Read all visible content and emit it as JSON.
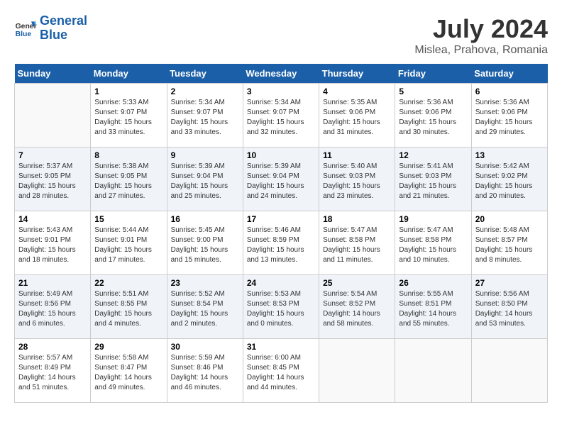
{
  "header": {
    "logo_line1": "General",
    "logo_line2": "Blue",
    "month": "July 2024",
    "location": "Mislea, Prahova, Romania"
  },
  "days_of_week": [
    "Sunday",
    "Monday",
    "Tuesday",
    "Wednesday",
    "Thursday",
    "Friday",
    "Saturday"
  ],
  "weeks": [
    [
      {
        "day": "",
        "sunrise": "",
        "sunset": "",
        "daylight": "",
        "empty": true
      },
      {
        "day": "1",
        "sunrise": "5:33 AM",
        "sunset": "9:07 PM",
        "daylight": "15 hours and 33 minutes."
      },
      {
        "day": "2",
        "sunrise": "5:34 AM",
        "sunset": "9:07 PM",
        "daylight": "15 hours and 33 minutes."
      },
      {
        "day": "3",
        "sunrise": "5:34 AM",
        "sunset": "9:07 PM",
        "daylight": "15 hours and 32 minutes."
      },
      {
        "day": "4",
        "sunrise": "5:35 AM",
        "sunset": "9:06 PM",
        "daylight": "15 hours and 31 minutes."
      },
      {
        "day": "5",
        "sunrise": "5:36 AM",
        "sunset": "9:06 PM",
        "daylight": "15 hours and 30 minutes."
      },
      {
        "day": "6",
        "sunrise": "5:36 AM",
        "sunset": "9:06 PM",
        "daylight": "15 hours and 29 minutes."
      }
    ],
    [
      {
        "day": "7",
        "sunrise": "5:37 AM",
        "sunset": "9:05 PM",
        "daylight": "15 hours and 28 minutes."
      },
      {
        "day": "8",
        "sunrise": "5:38 AM",
        "sunset": "9:05 PM",
        "daylight": "15 hours and 27 minutes."
      },
      {
        "day": "9",
        "sunrise": "5:39 AM",
        "sunset": "9:04 PM",
        "daylight": "15 hours and 25 minutes."
      },
      {
        "day": "10",
        "sunrise": "5:39 AM",
        "sunset": "9:04 PM",
        "daylight": "15 hours and 24 minutes."
      },
      {
        "day": "11",
        "sunrise": "5:40 AM",
        "sunset": "9:03 PM",
        "daylight": "15 hours and 23 minutes."
      },
      {
        "day": "12",
        "sunrise": "5:41 AM",
        "sunset": "9:03 PM",
        "daylight": "15 hours and 21 minutes."
      },
      {
        "day": "13",
        "sunrise": "5:42 AM",
        "sunset": "9:02 PM",
        "daylight": "15 hours and 20 minutes."
      }
    ],
    [
      {
        "day": "14",
        "sunrise": "5:43 AM",
        "sunset": "9:01 PM",
        "daylight": "15 hours and 18 minutes."
      },
      {
        "day": "15",
        "sunrise": "5:44 AM",
        "sunset": "9:01 PM",
        "daylight": "15 hours and 17 minutes."
      },
      {
        "day": "16",
        "sunrise": "5:45 AM",
        "sunset": "9:00 PM",
        "daylight": "15 hours and 15 minutes."
      },
      {
        "day": "17",
        "sunrise": "5:46 AM",
        "sunset": "8:59 PM",
        "daylight": "15 hours and 13 minutes."
      },
      {
        "day": "18",
        "sunrise": "5:47 AM",
        "sunset": "8:58 PM",
        "daylight": "15 hours and 11 minutes."
      },
      {
        "day": "19",
        "sunrise": "5:47 AM",
        "sunset": "8:58 PM",
        "daylight": "15 hours and 10 minutes."
      },
      {
        "day": "20",
        "sunrise": "5:48 AM",
        "sunset": "8:57 PM",
        "daylight": "15 hours and 8 minutes."
      }
    ],
    [
      {
        "day": "21",
        "sunrise": "5:49 AM",
        "sunset": "8:56 PM",
        "daylight": "15 hours and 6 minutes."
      },
      {
        "day": "22",
        "sunrise": "5:51 AM",
        "sunset": "8:55 PM",
        "daylight": "15 hours and 4 minutes."
      },
      {
        "day": "23",
        "sunrise": "5:52 AM",
        "sunset": "8:54 PM",
        "daylight": "15 hours and 2 minutes."
      },
      {
        "day": "24",
        "sunrise": "5:53 AM",
        "sunset": "8:53 PM",
        "daylight": "15 hours and 0 minutes."
      },
      {
        "day": "25",
        "sunrise": "5:54 AM",
        "sunset": "8:52 PM",
        "daylight": "14 hours and 58 minutes."
      },
      {
        "day": "26",
        "sunrise": "5:55 AM",
        "sunset": "8:51 PM",
        "daylight": "14 hours and 55 minutes."
      },
      {
        "day": "27",
        "sunrise": "5:56 AM",
        "sunset": "8:50 PM",
        "daylight": "14 hours and 53 minutes."
      }
    ],
    [
      {
        "day": "28",
        "sunrise": "5:57 AM",
        "sunset": "8:49 PM",
        "daylight": "14 hours and 51 minutes."
      },
      {
        "day": "29",
        "sunrise": "5:58 AM",
        "sunset": "8:47 PM",
        "daylight": "14 hours and 49 minutes."
      },
      {
        "day": "30",
        "sunrise": "5:59 AM",
        "sunset": "8:46 PM",
        "daylight": "14 hours and 46 minutes."
      },
      {
        "day": "31",
        "sunrise": "6:00 AM",
        "sunset": "8:45 PM",
        "daylight": "14 hours and 44 minutes."
      },
      {
        "day": "",
        "sunrise": "",
        "sunset": "",
        "daylight": "",
        "empty": true
      },
      {
        "day": "",
        "sunrise": "",
        "sunset": "",
        "daylight": "",
        "empty": true
      },
      {
        "day": "",
        "sunrise": "",
        "sunset": "",
        "daylight": "",
        "empty": true
      }
    ]
  ]
}
